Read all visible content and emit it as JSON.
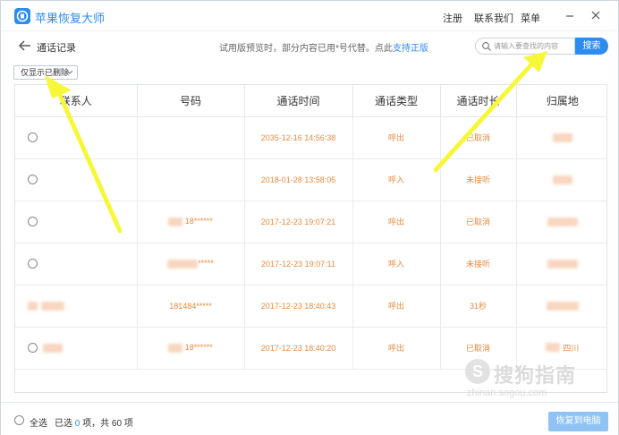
{
  "app": {
    "title": "苹果恢复大师",
    "menu": [
      "注册",
      "联系我们",
      "菜单"
    ],
    "window_controls": [
      "minimize-icon",
      "close-icon"
    ]
  },
  "toolbar": {
    "page_title": "通话记录",
    "notice_prefix": "试用版预览时，部分内容已用*号代替。点此",
    "notice_link": "支持正版",
    "search_placeholder": "请输入要查找的内容",
    "search_button": "搜索",
    "filter_label": "仅显示已删除"
  },
  "table": {
    "headers": [
      "联系人",
      "号码",
      "通话时间",
      "通话类型",
      "通话时长",
      "归属地"
    ],
    "rows": [
      {
        "contact": "",
        "number": "",
        "time": "2035-12-16 14:56:38",
        "type": "呼出",
        "duration": "已取消",
        "location": ""
      },
      {
        "contact": "",
        "number": "",
        "time": "2018-01-28 13:58:05",
        "type": "呼入",
        "duration": "未接听",
        "location": ""
      },
      {
        "contact": "",
        "number": "18******",
        "time": "2017-12-23 19:07:21",
        "type": "呼出",
        "duration": "已取消",
        "location": ""
      },
      {
        "contact": "",
        "number": "*****",
        "time": "2017-12-23 19:07:11",
        "type": "呼入",
        "duration": "未接听",
        "location": ""
      },
      {
        "contact": "",
        "number": "181484*****",
        "time": "2017-12-23 18:40:43",
        "type": "呼出",
        "duration": "31秒",
        "location": ""
      },
      {
        "contact": "",
        "number": "18******",
        "time": "2017-12-23 18:40:20",
        "type": "呼出",
        "duration": "已取消",
        "location": "四川"
      }
    ]
  },
  "footer": {
    "select_all": "全选",
    "selected_prefix": "已选 ",
    "selected_count": "0",
    "selected_suffix": " 项，共 60 项",
    "restore_button": "恢复到电脑"
  },
  "watermark": {
    "logo_char": "S",
    "text": "搜狗指南",
    "url": "zhinan.sogou.com"
  },
  "colors": {
    "accent": "#2d8cf0",
    "data_text": "#e98a3f",
    "arrow": "#f7f73a"
  }
}
